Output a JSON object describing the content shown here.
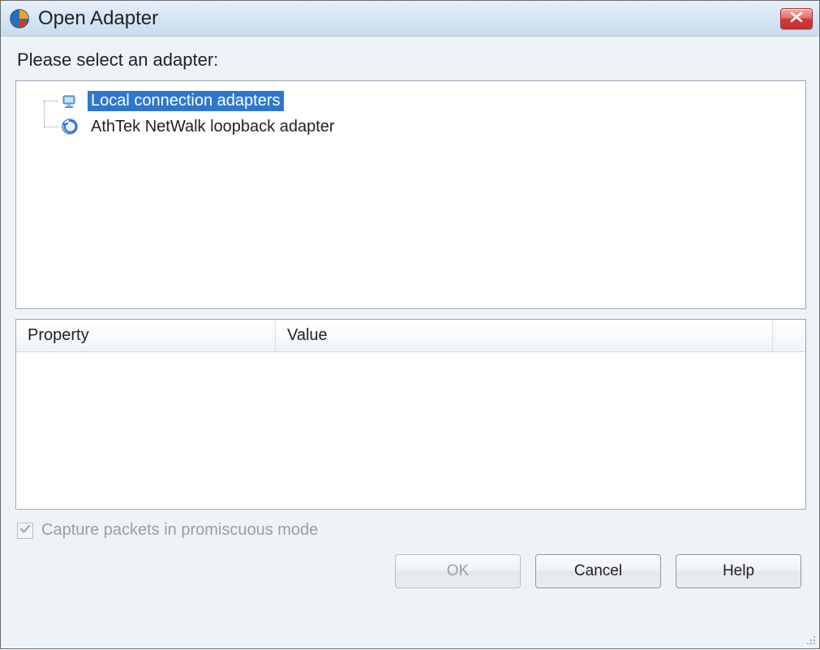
{
  "window": {
    "title": "Open Adapter"
  },
  "instruction": "Please select an adapter:",
  "tree": {
    "items": [
      {
        "label": "Local connection adapters",
        "selected": true,
        "icon": "adapter-group-icon"
      },
      {
        "label": "AthTek NetWalk loopback adapter",
        "selected": false,
        "icon": "loopback-adapter-icon"
      }
    ]
  },
  "listview": {
    "columns": {
      "property": "Property",
      "value": "Value"
    },
    "rows": []
  },
  "checkbox": {
    "label": "Capture packets in promiscuous mode",
    "checked": true,
    "disabled": true
  },
  "buttons": {
    "ok": "OK",
    "cancel": "Cancel",
    "help": "Help",
    "ok_disabled": true
  }
}
